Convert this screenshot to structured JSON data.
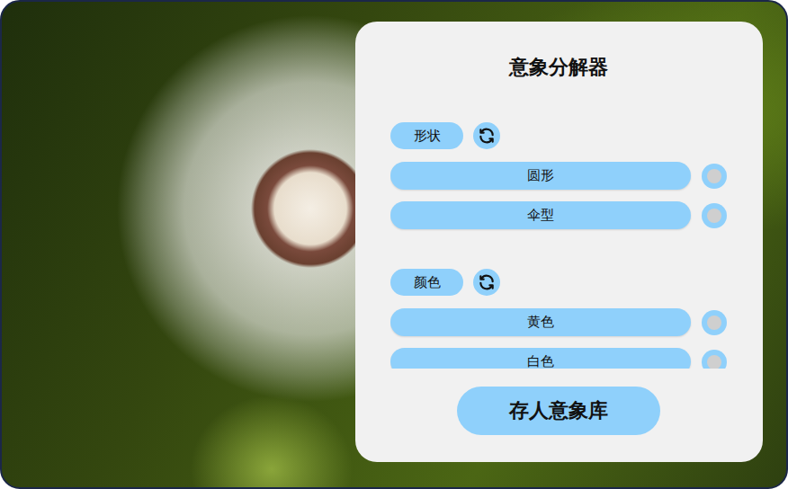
{
  "panel": {
    "title": "意象分解器"
  },
  "groups": [
    {
      "label": "形状",
      "options": [
        {
          "label": "圆形",
          "selected": false
        },
        {
          "label": "伞型",
          "selected": false
        }
      ]
    },
    {
      "label": "颜色",
      "options": [
        {
          "label": "黄色",
          "selected": false
        },
        {
          "label": "白色",
          "selected": false
        }
      ]
    }
  ],
  "buttons": [
    "存人意象库"
  ]
}
